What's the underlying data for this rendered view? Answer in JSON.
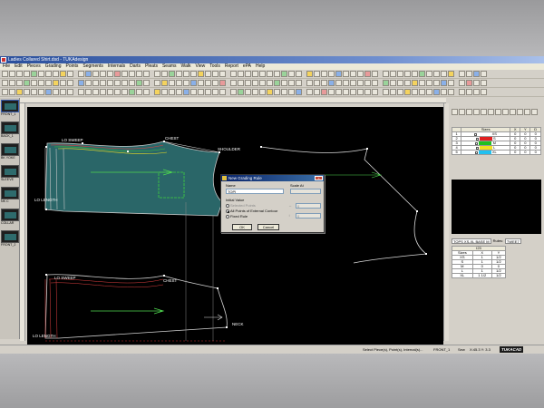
{
  "window": {
    "title": "Ladies Collared Shirt.dsd - TUKAdesign"
  },
  "menu": [
    "File",
    "Edit",
    "Pieces",
    "Grading",
    "Points",
    "Segments",
    "Internals",
    "Darts",
    "Pleats",
    "Seams",
    "Walk",
    "View",
    "Tools",
    "Report",
    "ePA",
    "Help"
  ],
  "pieces": [
    {
      "label": "FRONT_1",
      "selected": true
    },
    {
      "label": "BACK_1"
    },
    {
      "label": "BK YOKE"
    },
    {
      "label": "SLEEVE"
    },
    {
      "label": "NK C"
    },
    {
      "label": "COLLAR"
    },
    {
      "label": "FRONT_2"
    }
  ],
  "canvas_labels": {
    "lo_sweep_top": "LO SWEEP",
    "chest_top": "CHEST",
    "shoulder": "SHOULDER",
    "lo_length_top": "LO LENGTH",
    "lo_sweep_bottom": "LO SWEEP",
    "chest_bottom": "CHEST",
    "neck": "NECK",
    "lo_length_bottom": "LO LENGTH"
  },
  "size_table": {
    "headers": [
      "",
      "Sizes",
      "X",
      "Y",
      "D"
    ],
    "rows": [
      {
        "num": "1",
        "size": "XS",
        "color": "#ffffff",
        "x": "0",
        "y": "0",
        "d": "0"
      },
      {
        "num": "2",
        "size": "S",
        "color": "#e02020",
        "x": "0",
        "y": "0",
        "d": "0"
      },
      {
        "num": "3",
        "size": "M",
        "color": "#20c020",
        "x": "0",
        "y": "0",
        "d": "0"
      },
      {
        "num": "4",
        "size": "L",
        "color": "#f0e020",
        "x": "0",
        "y": "0",
        "d": "0"
      },
      {
        "num": "5",
        "size": "XL",
        "color": "#20c0f0",
        "x": "0",
        "y": "0",
        "d": "0"
      }
    ]
  },
  "rule_panel": {
    "table": "TOPS XS-XL BASE M",
    "rules_label": "Rules:",
    "rules_value": "TWEE7"
  },
  "grade_table": {
    "title": "I23",
    "headers": [
      "Sizes",
      "X",
      "Y"
    ],
    "rows": [
      [
        "XS",
        "1",
        "1/2"
      ],
      [
        "S",
        "1",
        "1/2"
      ],
      [
        "M",
        "0",
        "0"
      ],
      [
        "L",
        "1",
        "1/2"
      ],
      [
        "XL",
        "1 1/2",
        "1/2"
      ]
    ]
  },
  "status": {
    "hint": "Select Piece(s), Point(s), Internal(s)...",
    "piece": "FRONT_1",
    "mode": "Sew",
    "coord": "X:45.3  Y: 3.3",
    "logo": "TUKACAD"
  },
  "dialog": {
    "title": "New Grading Rule",
    "name_label": "Name",
    "name_value": "TOPI",
    "scale_label": "Scale At",
    "initial_value_label": "Initial Value",
    "selected_points_label": "Selected Points",
    "all_points_label": "All Points of External Contour",
    "fixed_rule_label": "Fixed Rule",
    "x_value": "0",
    "y_value": "0",
    "ok_label": "OK",
    "cancel_label": "Cancel"
  }
}
